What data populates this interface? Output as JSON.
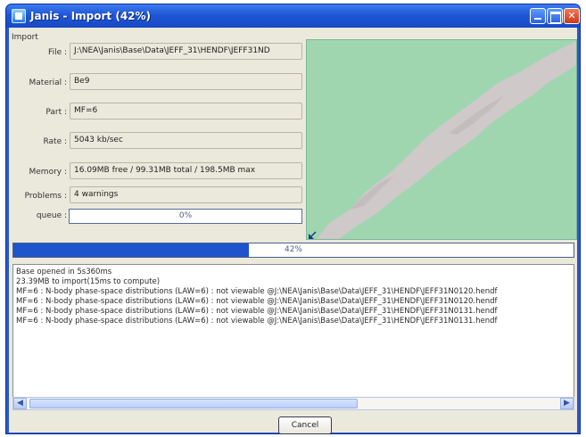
{
  "window": {
    "title": "Janis - Import (42%)"
  },
  "import_label": "Import",
  "fields": [
    {
      "label": "File :",
      "value": "J:\\NEA\\Janis\\Base\\Data\\JEFF_31\\HENDF\\JEFF31ND"
    },
    {
      "label": "Material :",
      "value": "Be9"
    },
    {
      "label": "Part :",
      "value": "MF=6"
    },
    {
      "label": "Rate :",
      "value": "5043 kb/sec"
    },
    {
      "label": "Memory :",
      "value": "16.09MB free / 99.31MB total / 198.5MB max"
    },
    {
      "label": "Problems :",
      "value": "4 warnings"
    }
  ],
  "queue": {
    "label": "queue :",
    "text": "0%",
    "progress": 0
  },
  "main_progress": {
    "text": "42%",
    "progress": 0.42
  },
  "log_lines": [
    "Base opened in 5s360ms",
    "23.39MB to import(15ms to compute)",
    "MF=6 : N-body phase-space distributions (LAW=6) : not viewable @J:\\NEA\\Janis\\Base\\Data\\JEFF_31\\HENDF\\JEFF31N0120.hendf",
    "MF=6 : N-body phase-space distributions (LAW=6) : not viewable @J:\\NEA\\Janis\\Base\\Data\\JEFF_31\\HENDF\\JEFF31N0120.hendf",
    "MF=6 : N-body phase-space distributions (LAW=6) : not viewable @J:\\NEA\\Janis\\Base\\Data\\JEFF_31\\HENDF\\JEFF31N0131.hendf",
    "MF=6 : N-body phase-space distributions (LAW=6) : not viewable @J:\\NEA\\Janis\\Base\\Data\\JEFF_31\\HENDF\\JEFF31N0131.hendf"
  ],
  "buttons": {
    "cancel": "Cancel"
  },
  "icons": {
    "app": "janis-app-icon",
    "minimize": "minimize-icon",
    "maximize": "maximize-icon",
    "close": "close-icon",
    "scroll_left": "scroll-left-arrow-icon",
    "scroll_right": "scroll-right-arrow-icon",
    "resize_corner": "resize-arrow-icon"
  },
  "colors": {
    "titlebar": "#1f56d6",
    "progress_fill": "#1e54cc",
    "preview_background": "#9fd6b0",
    "preview_band": "#cfc9c9",
    "dialog_background": "#ebe9dc"
  }
}
